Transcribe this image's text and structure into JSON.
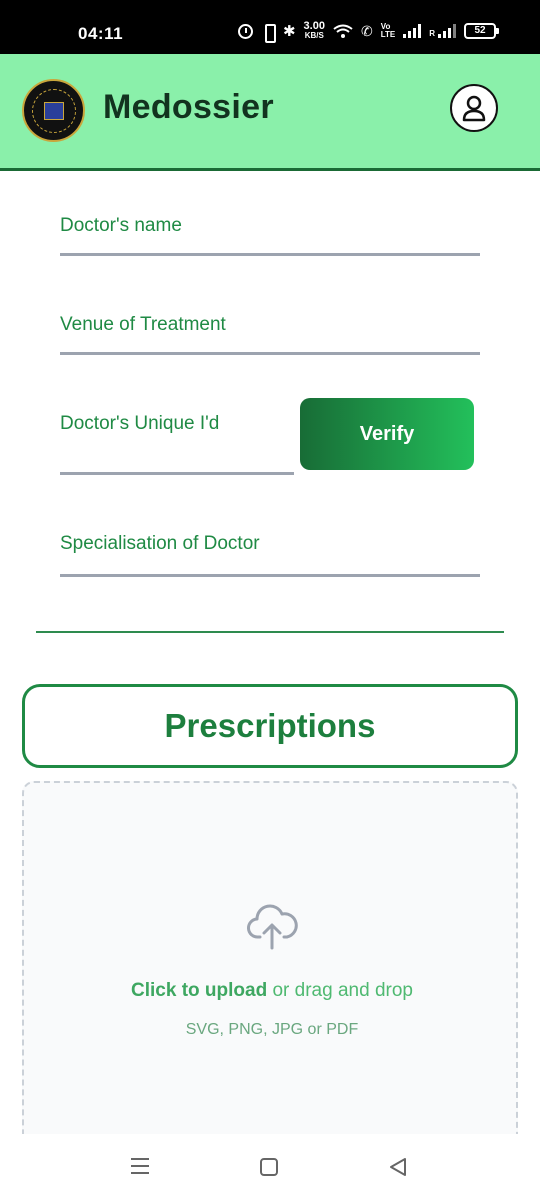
{
  "status_bar": {
    "time": "04:11",
    "speed_value": "3.00",
    "speed_unit": "KB/S",
    "volte_top": "Vo",
    "volte_bottom": "LTE",
    "roaming_label": "R",
    "battery": "52",
    "icons": [
      "alarm-icon",
      "vibrate-icon",
      "bluetooth-icon",
      "wifi-icon",
      "wifi-calling-icon",
      "volte-icon",
      "signal-icon",
      "signal-roaming-icon",
      "battery-icon"
    ]
  },
  "header": {
    "app_title": "Medossier",
    "logo_icon": "medossier-logo",
    "profile_icon": "user-profile-icon",
    "background": "#8af0aa"
  },
  "form": {
    "doctor_name_label": "Doctor's name",
    "venue_label": "Venue of Treatment",
    "doctor_id_label": "Doctor's Unique I'd",
    "verify_label": "Verify",
    "specialisation_label": "Specialisation of Doctor"
  },
  "prescriptions": {
    "title": "Prescriptions",
    "upload_icon": "cloud-upload-icon",
    "upload_action": "Click to upload",
    "upload_rest": " or drag and drop",
    "upload_formats": "SVG, PNG, JPG or PDF"
  },
  "nav_bar": {
    "icons": [
      "recents-icon",
      "home-icon",
      "back-icon"
    ]
  },
  "colors": {
    "accent_green": "#1f8a44",
    "header_green": "#8af0aa",
    "button_gradient_start": "#186c36",
    "button_gradient_end": "#23c05b"
  }
}
